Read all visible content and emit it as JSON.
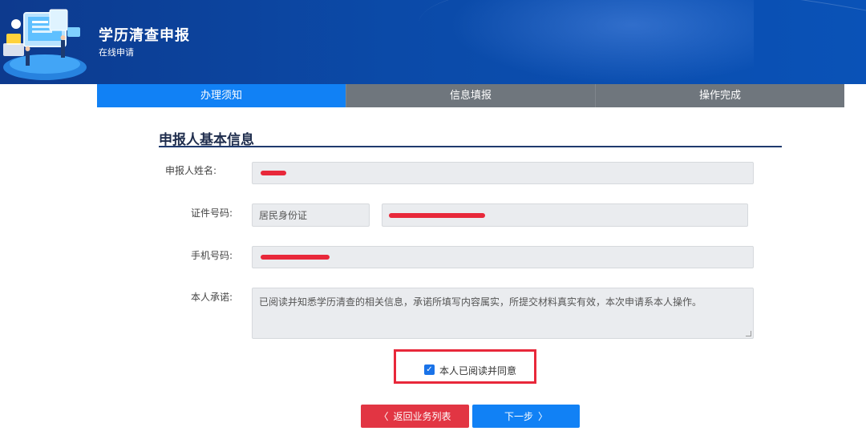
{
  "header": {
    "title": "学历清查申报",
    "subtitle": "在线申请"
  },
  "steps": [
    {
      "label": "办理须知",
      "active": true
    },
    {
      "label": "信息填报",
      "active": false
    },
    {
      "label": "操作完成",
      "active": false
    }
  ],
  "section": {
    "title": "申报人基本信息"
  },
  "form": {
    "name_label": "申报人姓名:",
    "id_label": "证件号码:",
    "id_type": "居民身份证",
    "phone_label": "手机号码:",
    "promise_label": "本人承诺:",
    "promise_text": "已阅读并知悉学历清查的相关信息，承诺所填写内容属实，所提交材料真实有效，本次申请系本人操作。"
  },
  "agree": {
    "label": "本人已阅读并同意",
    "checked": true
  },
  "buttons": {
    "back": "返回业务列表",
    "next": "下一步"
  },
  "colors": {
    "primary": "#1181f5",
    "danger": "#e23543",
    "step_inactive": "#6f767d",
    "header": "#0b4aa8"
  }
}
